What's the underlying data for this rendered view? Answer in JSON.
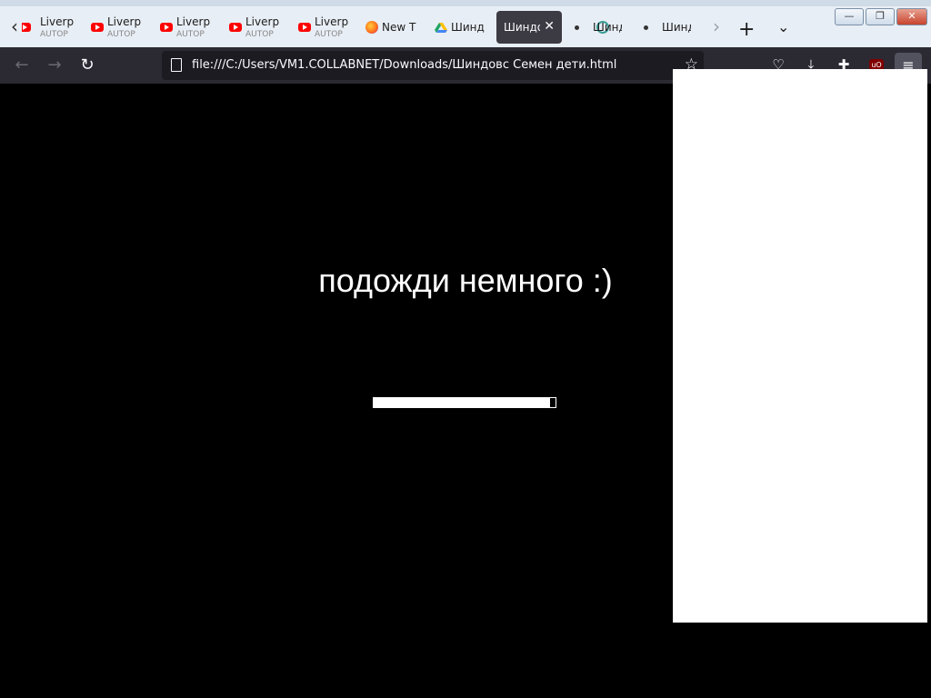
{
  "browser": {
    "tabs": [
      {
        "title": "Liverp",
        "subtitle": "AUTOP",
        "icon": "youtube-icon"
      },
      {
        "title": "Liverp",
        "subtitle": "AUTOP",
        "icon": "youtube-icon"
      },
      {
        "title": "Liverp",
        "subtitle": "AUTOP",
        "icon": "youtube-icon"
      },
      {
        "title": "Liverp",
        "subtitle": "AUTOP",
        "icon": "youtube-icon"
      },
      {
        "title": "Liverp",
        "subtitle": "AUTOP",
        "icon": "youtube-icon"
      },
      {
        "title": "New T",
        "icon": "firefox-icon"
      },
      {
        "title": "Шинд",
        "icon": "google-drive-icon"
      },
      {
        "title": "Шиндо",
        "icon": "none",
        "active": true
      },
      {
        "title": "Шинд",
        "icon": "loading-icon"
      },
      {
        "title": "Шинд",
        "icon": "dot-icon"
      }
    ],
    "url": "file:///C:/Users/VM1.COLLABNET/Downloads/Шиндовс Семен дети.html",
    "colors": {
      "toolbar": "#2b2a33",
      "tabstrip": "#e8eef5",
      "active_tab": "#3c3a43"
    }
  },
  "page": {
    "message": "подожди немного :)",
    "progress": 0.97,
    "background": "#000000"
  }
}
